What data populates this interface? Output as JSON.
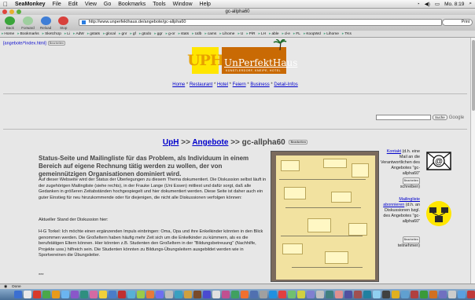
{
  "menubar": {
    "app_name": "SeaMonkey",
    "items": [
      "File",
      "Edit",
      "View",
      "Go",
      "Bookmarks",
      "Tools",
      "Window",
      "Help"
    ],
    "clock": "Mo. 8:19"
  },
  "window": {
    "title": "gc-allpha60"
  },
  "navbar": {
    "back": "Back",
    "forward": "Forward",
    "reload": "Reload",
    "stop": "Stop",
    "url": "http://www.unperfekthaus.de/angebote/gc-allpha60",
    "search_label": "Print"
  },
  "bookmarks": [
    "Home",
    "Bookmarks",
    "SketchUp",
    "Li",
    "AdW",
    "gstats",
    "glocal",
    "gnr",
    "gf",
    "gtodo",
    "ggr",
    "g-or",
    "stats",
    "Udb",
    "cams",
    "Lihome",
    "U",
    "PiR",
    "LH",
    "able",
    "d-e",
    "FL",
    "KoopWd",
    "Lihome",
    "TKs"
  ],
  "page": {
    "top_crumb": "[angebote/*index.html]",
    "bearbeiten": "Bearbeiten",
    "logo_letters": "UPH",
    "logo_name": "UnPerfektHaus",
    "logo_tagline": "KÜNSTLERDORF, KNEIPE, HOTEL",
    "nav": {
      "home": "Home",
      "restaurant": "Restaurant",
      "hotel": "Hotel",
      "feiern": "Feiern",
      "business": "Business",
      "detail": "Detail-Infos",
      "sep": " * "
    },
    "search_button": "Suche",
    "google": "Google",
    "heading_uph": "UpH",
    "heading_sep1": " >> ",
    "heading_angebote": "Angebote",
    "heading_sep2": " >> gc-allpha60 ",
    "intro": "Status-Seite und Mailingliste für das Problem, als Individuum in einem Bereich auf eigene Rechnung tätig werden zu wollen, der von gemeinnützigen Organisationen dominiert wird.",
    "body1": "Auf dieser Webseite wird der Status der Überlegungen zu diesem Thema dokumentiert. Die Diskussion selbst läuft in der zugehörigen Mailingliste (siehe rechts), in der Frauke Lange (Uni Essen) mitliest und dafür sorgt, daß alle Gedanken in größeren Zeitabständen hochgespiegelt und hier dokumentiert werden. Diese Seite ist daher auch ein guter Einstieg für neu hinzukommende oder für diejenigen, die nicht alle Diskussionen verfolgen können:",
    "body2": "Aktueller Stand der Diskussion hier:",
    "body3": "H-G Torkel: Ich möchte einen ergänzenden Impuls einbringen: Oma, Opa und ihre Enkelkinder könnten in den Blick genommen werden. Die Großeltern haben häufig mehr Zeit sich um die Enkelkinder zu kümmern, als es die berufstätigen Eltern können. Hier könnten z.B. Studenten den Großeltern in der \"Bildungsbetreuung\" (Nachhilfe, Projekte usw.) hilfreich sein. Die Studenten könnten zu Bildungs-Übungsleitern ausgebildet werden wie in Sportvereinen die Übungsleiter.",
    "dots": "***",
    "side": {
      "kontakt": "Kontakt",
      "kontakt_text": " (d.h. eine Mail an die Verantwortlichen des Angebotes \"gc-allpha60\"",
      "kontakt_tail": " schreiben)",
      "ml": "Mailingliste abonnieren",
      "ml_text": " (d.h. an Diskussionen bzgl. des Angebotes \"gc-allpha60\"",
      "ml_tail": " teilnehmen)"
    }
  },
  "status": {
    "text": "Done"
  },
  "colors": {
    "link": "#0000cc",
    "logo_yellow": "#ffe600",
    "logo_orange": "#c96a04"
  }
}
